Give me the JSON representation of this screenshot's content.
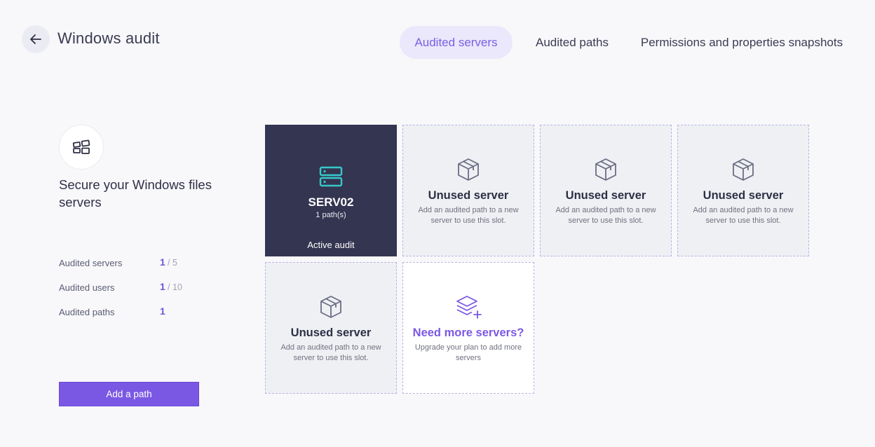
{
  "header": {
    "title": "Windows audit",
    "tabs": [
      {
        "label": "Audited servers",
        "active": true
      },
      {
        "label": "Audited paths",
        "active": false
      },
      {
        "label": "Permissions and properties snapshots",
        "active": false
      }
    ]
  },
  "side": {
    "headline": "Secure your Windows files servers",
    "stats": [
      {
        "label": "Audited servers",
        "value": "1",
        "total": "/ 5"
      },
      {
        "label": "Audited users",
        "value": "1",
        "total": "/ 10"
      },
      {
        "label": "Audited paths",
        "value": "1",
        "total": ""
      }
    ],
    "add_button": "Add a path"
  },
  "grid": {
    "active_server": {
      "name": "SERV02",
      "paths": "1 path(s)",
      "status": "Active audit"
    },
    "unused_title": "Unused server",
    "unused_desc": "Add an audited path to a new server to use this slot.",
    "upsell": {
      "title": "Need more servers?",
      "desc": "Upgrade your plan to add more servers"
    }
  },
  "colors": {
    "accent": "#7b58e4",
    "active_tile": "#343551",
    "server_icon": "#37c7c9"
  }
}
